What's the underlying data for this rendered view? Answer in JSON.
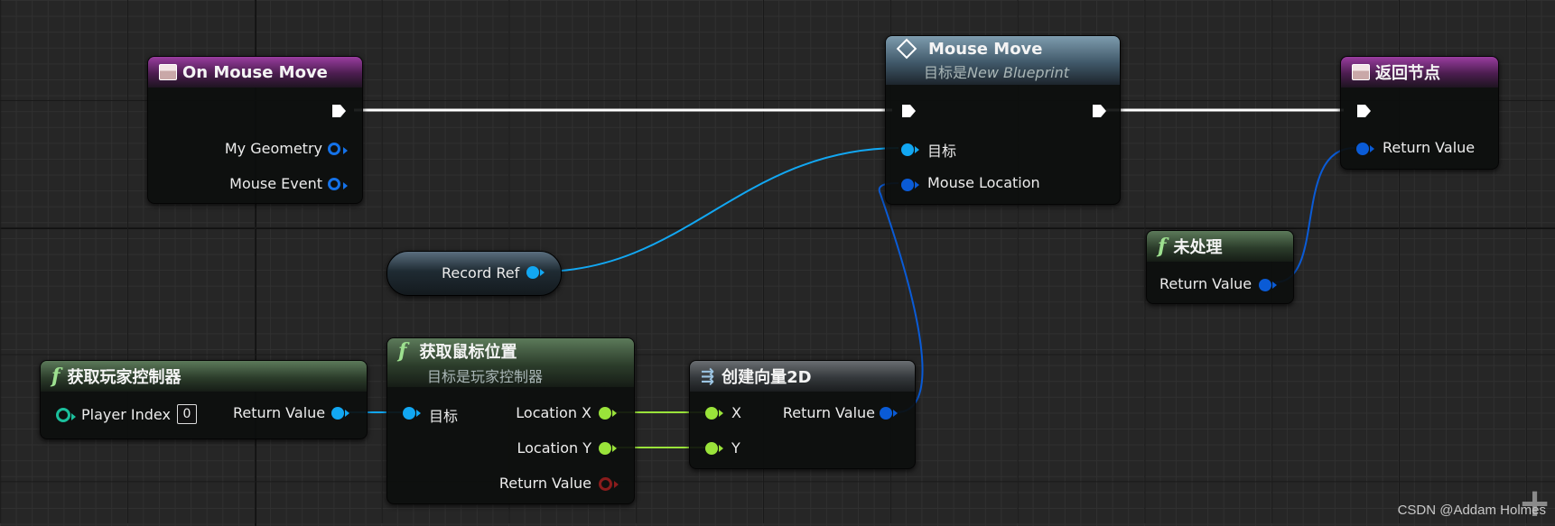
{
  "nodes": {
    "on_mouse_move": {
      "title": "On Mouse Move",
      "pins": [
        "My Geometry",
        "Mouse Event"
      ]
    },
    "mouse_move": {
      "title": "Mouse Move",
      "subtitle_prefix": "目标是",
      "subtitle_target": "New Blueprint",
      "pins": [
        "目标",
        "Mouse Location"
      ]
    },
    "return_node": {
      "title": "返回节点",
      "pins": [
        "Return Value"
      ]
    },
    "unhandled": {
      "title": "未处理",
      "pins": [
        "Return Value"
      ]
    },
    "record_ref": {
      "label": "Record Ref"
    },
    "get_player_controller": {
      "title": "获取玩家控制器",
      "pins": [
        "Player Index",
        "Return Value"
      ],
      "player_index_value": "0"
    },
    "get_mouse_position": {
      "title": "获取鼠标位置",
      "subtitle": "目标是玩家控制器",
      "pins": [
        "目标",
        "Location X",
        "Location Y",
        "Return Value"
      ]
    },
    "make_vector2d": {
      "title": "创建向量2D",
      "pins": [
        "X",
        "Y",
        "Return Value"
      ]
    }
  },
  "watermark": "CSDN @Addam Holmes",
  "colors": {
    "exec_wire": "#ffffff",
    "object_pin": "#12a7f2",
    "struct_pin": "#0a5bd6",
    "float_pin": "#9ae33a",
    "event_header": "#9a3da0",
    "function_header": "#5c7a5a",
    "message_header": "#7e9cae"
  },
  "icons": [
    "event-icon",
    "function-icon",
    "message-icon",
    "vector-icon",
    "add-icon"
  ]
}
